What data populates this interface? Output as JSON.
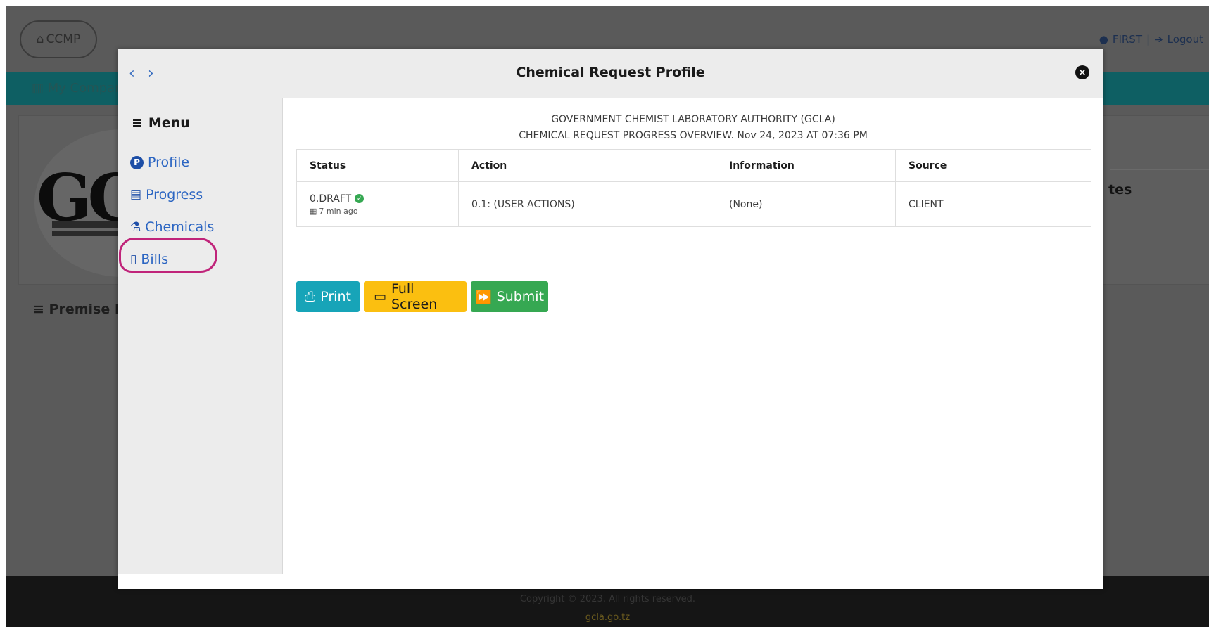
{
  "background": {
    "home_label": "CCMP",
    "user_label": "FIRST",
    "logout_label": "Logout",
    "company_label": "My Compan",
    "logo_text": "GC",
    "premise_label": "Premise M",
    "right_card_label": "tes",
    "footer_copyright": "Copyright © 2023. All rights reserved.",
    "footer_site": "gcla.go.tz"
  },
  "modal": {
    "title": "Chemical Request Profile",
    "prev_icon": "‹",
    "next_icon": "›",
    "close_icon": "×"
  },
  "sidebar": {
    "menu_label": "Menu",
    "items": [
      {
        "label": "Profile",
        "icon": "profile-icon"
      },
      {
        "label": "Progress",
        "icon": "progress-icon"
      },
      {
        "label": "Chemicals",
        "icon": "flask-icon"
      },
      {
        "label": "Bills",
        "icon": "document-icon"
      }
    ]
  },
  "report": {
    "authority": "GOVERNMENT CHEMIST LABORATORY AUTHORITY (GCLA)",
    "overview": "CHEMICAL REQUEST PROGRESS OVERVIEW. Nov 24, 2023 AT 07:36 PM"
  },
  "table": {
    "headers": [
      "Status",
      "Action",
      "Information",
      "Source"
    ],
    "rows": [
      {
        "status": "0.DRAFT",
        "status_time": "7 min ago",
        "action": "0.1: (USER ACTIONS)",
        "information": "(None)",
        "source": "CLIENT"
      }
    ]
  },
  "buttons": {
    "print": "Print",
    "full_screen": "Full Screen",
    "submit": "Submit"
  },
  "colors": {
    "accent_blue": "#2b65c2",
    "print": "#17a4b8",
    "full_screen": "#fbbf10",
    "submit": "#36a852",
    "annotation": "#c0247a"
  }
}
